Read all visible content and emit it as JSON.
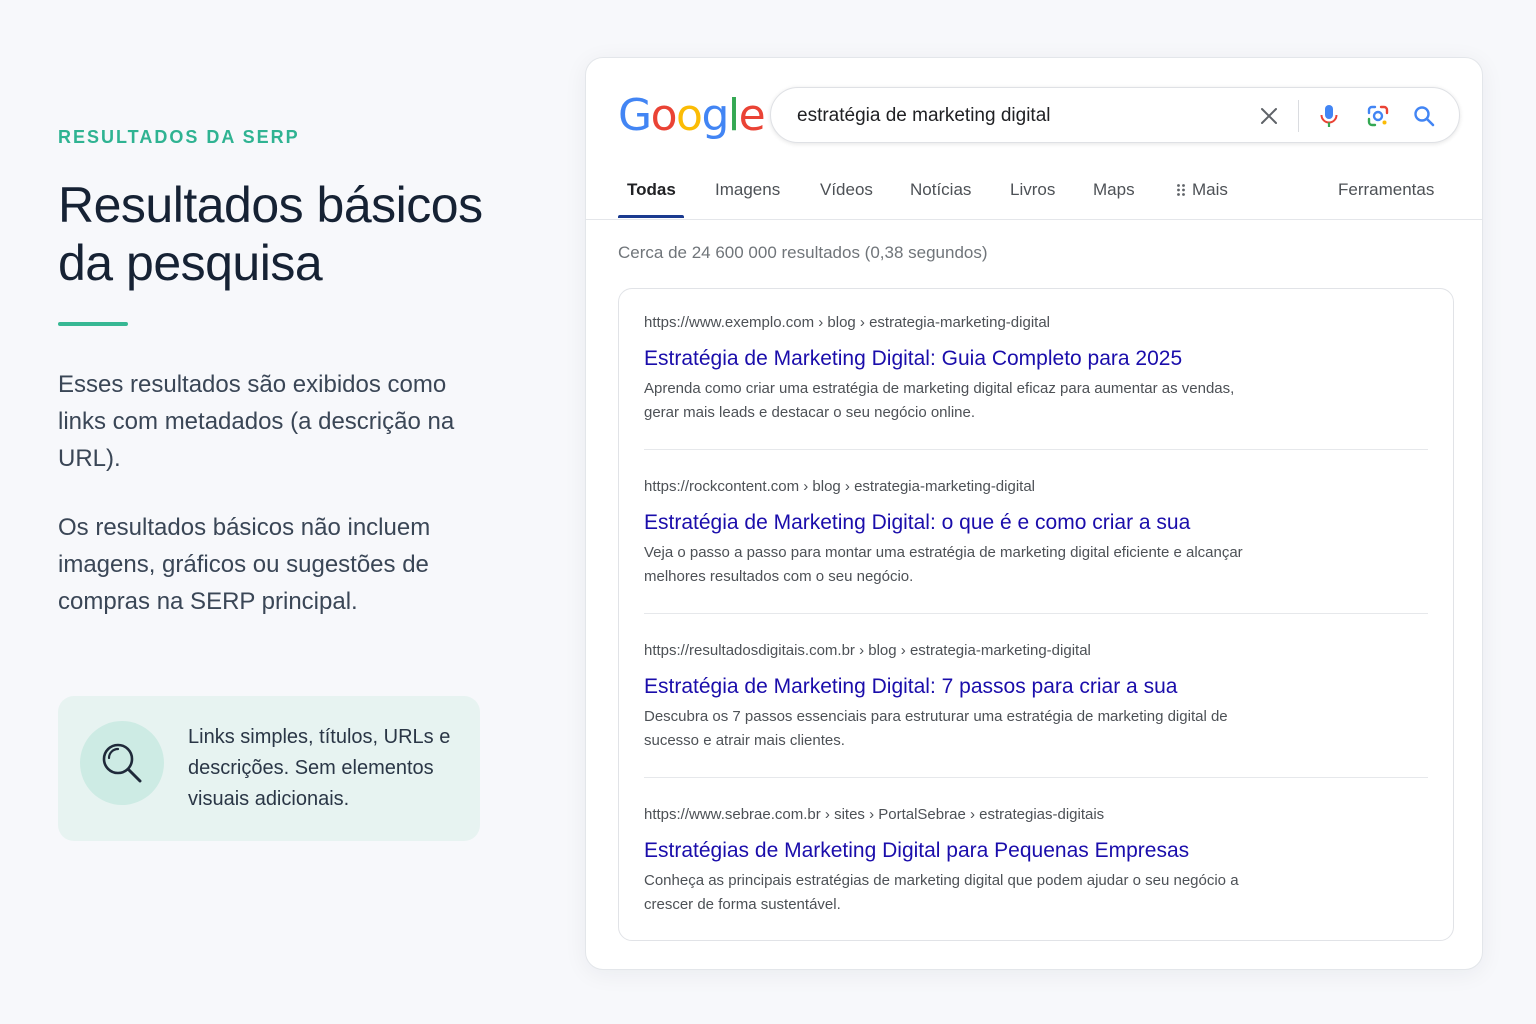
{
  "info": {
    "eyebrow": "RESULTADOS DA SERP",
    "headline": "Resultados básicos da pesquisa",
    "paragraph1": "Esses resultados são exibidos como links com metadados (a descrição na URL).",
    "paragraph2": "Os resultados básicos não incluem imagens, gráficos ou sugestões de compras na SERP principal.",
    "note": "Links simples, títulos, URLs e descrições. Sem elementos visuais adicionais.",
    "accent_color": "#37b894"
  },
  "serp": {
    "logo": [
      "G",
      "o",
      "o",
      "g",
      "l",
      "e"
    ],
    "search": {
      "value": "estratégia de marketing digital",
      "icons": [
        "close-icon",
        "microphone-icon",
        "lens-icon",
        "search-icon"
      ]
    },
    "tabs": [
      {
        "label": "Todas",
        "active": true
      },
      {
        "label": "Imagens"
      },
      {
        "label": "Vídeos"
      },
      {
        "label": "Notícias"
      },
      {
        "label": "Livros"
      },
      {
        "label": "Maps"
      },
      {
        "label": "Mais"
      },
      {
        "label": "Ferramentas"
      }
    ],
    "stats": "Cerca de 24 600 000 resultados (0,38 segundos)",
    "results": [
      {
        "url": "https://www.exemplo.com › blog › estrategia-marketing-digital",
        "title": "Estratégia de Marketing Digital: Guia Completo para 2025",
        "description": "Aprenda como criar uma estratégia de marketing digital eficaz para aumentar as vendas, gerar mais leads e destacar o seu negócio online."
      },
      {
        "url": "https://rockcontent.com › blog › estrategia-marketing-digital",
        "title": "Estratégia de Marketing Digital: o que é e como criar a sua",
        "description": "Veja o passo a passo para montar uma estratégia de marketing digital eficiente e alcançar melhores resultados com o seu negócio."
      },
      {
        "url": "https://resultadosdigitais.com.br › blog › estrategia-marketing-digital",
        "title": "Estratégia de Marketing Digital: 7 passos para criar a sua",
        "description": "Descubra os 7 passos essenciais para estruturar uma estratégia de marketing digital de sucesso e atrair mais clientes."
      },
      {
        "url": "https://www.sebrae.com.br › sites › PortalSebrae › estrategias-digitais",
        "title": "Estratégias de Marketing Digital para Pequenas Empresas",
        "description": "Conheça as principais estratégias de marketing digital que podem ajudar o seu negócio a crescer de forma sustentável."
      }
    ],
    "link_color": "#1a0dab"
  }
}
